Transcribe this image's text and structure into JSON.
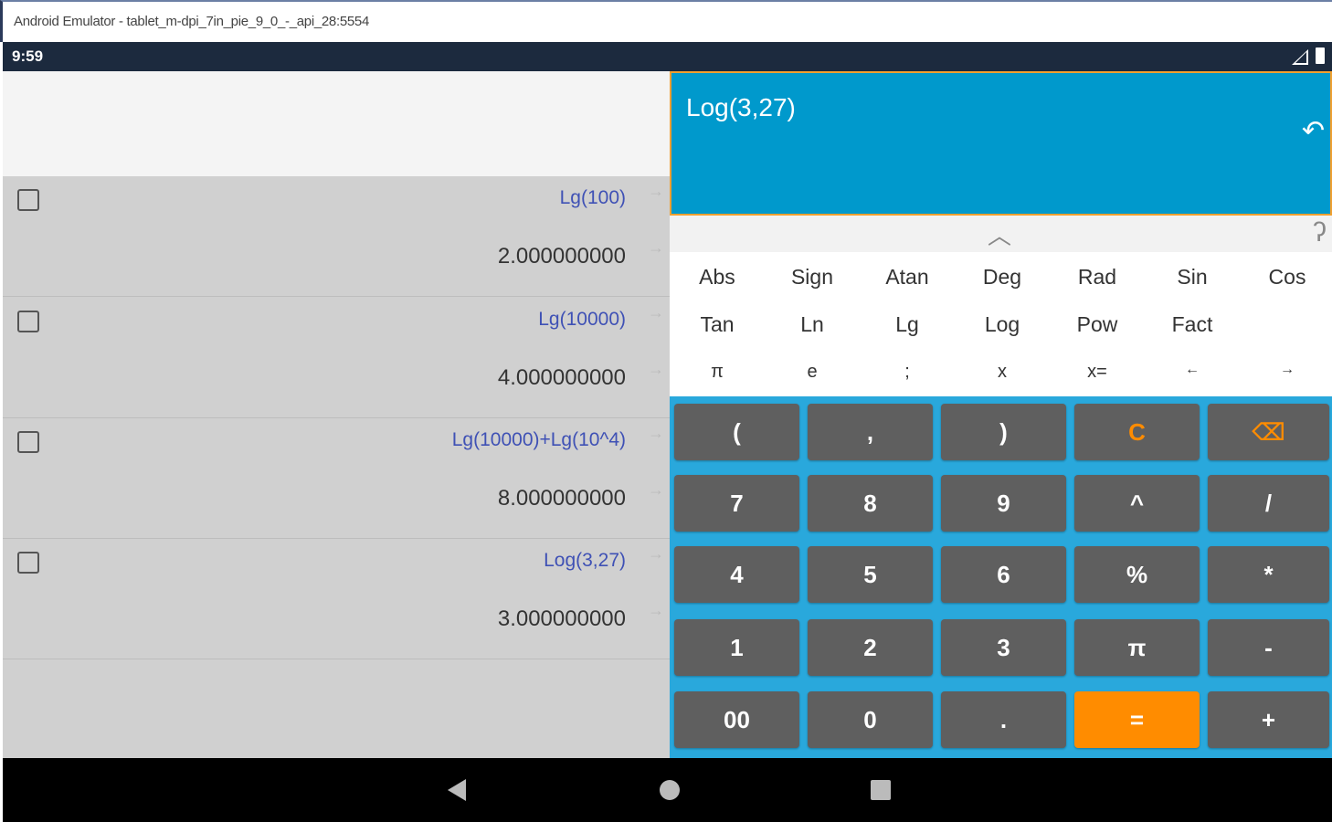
{
  "window": {
    "title": "Android Emulator - tablet_m-dpi_7in_pie_9_0_-_api_28:5554"
  },
  "status": {
    "time": "9:59"
  },
  "history": [
    {
      "expression": "Lg(100)",
      "result": "2.000000000"
    },
    {
      "expression": "Lg(10000)",
      "result": "4.000000000"
    },
    {
      "expression": "Lg(10000)+Lg(10^4)",
      "result": "8.000000000"
    },
    {
      "expression": "Log(3,27)",
      "result": "3.000000000"
    }
  ],
  "history_arrow": "→",
  "display": {
    "expression": "Log(3,27)",
    "undo_icon": "↶"
  },
  "panel_handle": {
    "up_icon": "︿",
    "help_icon": "ʔ"
  },
  "functions": {
    "row1": [
      "Abs",
      "Sign",
      "Atan",
      "Deg",
      "Rad",
      "Sin",
      "Cos"
    ],
    "row2": [
      "Tan",
      "Ln",
      "Lg",
      "Log",
      "Pow",
      "Fact"
    ],
    "row3": [
      "π",
      "e",
      ";",
      "x",
      "x=",
      "←",
      "→"
    ]
  },
  "keypad": {
    "row1": [
      "(",
      ",",
      ")",
      "C",
      "⌫"
    ],
    "row2": [
      "7",
      "8",
      "9",
      "^",
      "/"
    ],
    "row3": [
      "4",
      "5",
      "6",
      "%",
      "*"
    ],
    "row4": [
      "1",
      "2",
      "3",
      "π",
      "-"
    ],
    "row5": [
      "00",
      "0",
      ".",
      "=",
      "+"
    ]
  },
  "colors": {
    "display_bg": "#0099cc",
    "keypad_bg": "#29a8dc",
    "key_bg": "#5f5f5f",
    "accent": "#ff8c00",
    "history_expr": "#3f51b5"
  }
}
